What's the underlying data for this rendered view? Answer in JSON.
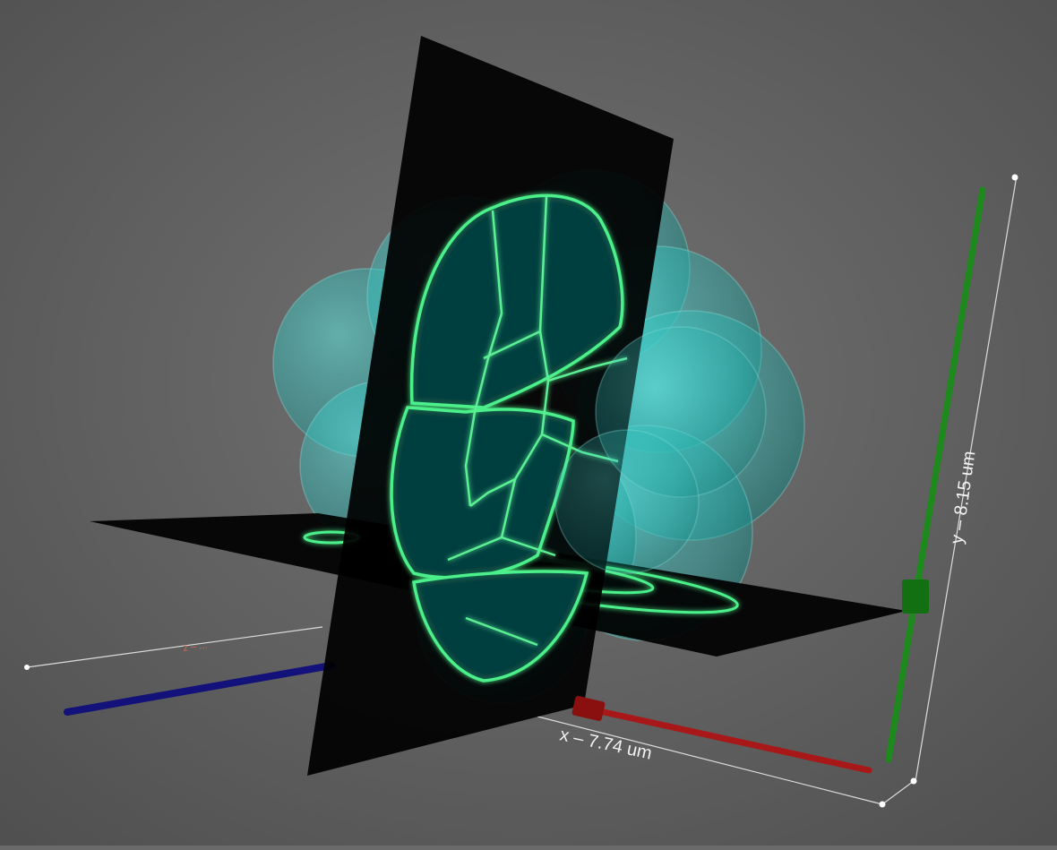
{
  "scene": {
    "background_color": "#6a6a6a",
    "object": "translucent-cell-cluster",
    "cell_color": "#2ec6c2",
    "membrane_section_color": "#4cf08a",
    "slice_plane_color": "#000000"
  },
  "axes": {
    "x": {
      "label": "x  –  7.74 um",
      "color": "#a81818"
    },
    "y": {
      "label": "y  –  8.15 um",
      "color": "#1e8a1e"
    },
    "z": {
      "label": "z  –  ...",
      "color": "#12127a"
    }
  }
}
